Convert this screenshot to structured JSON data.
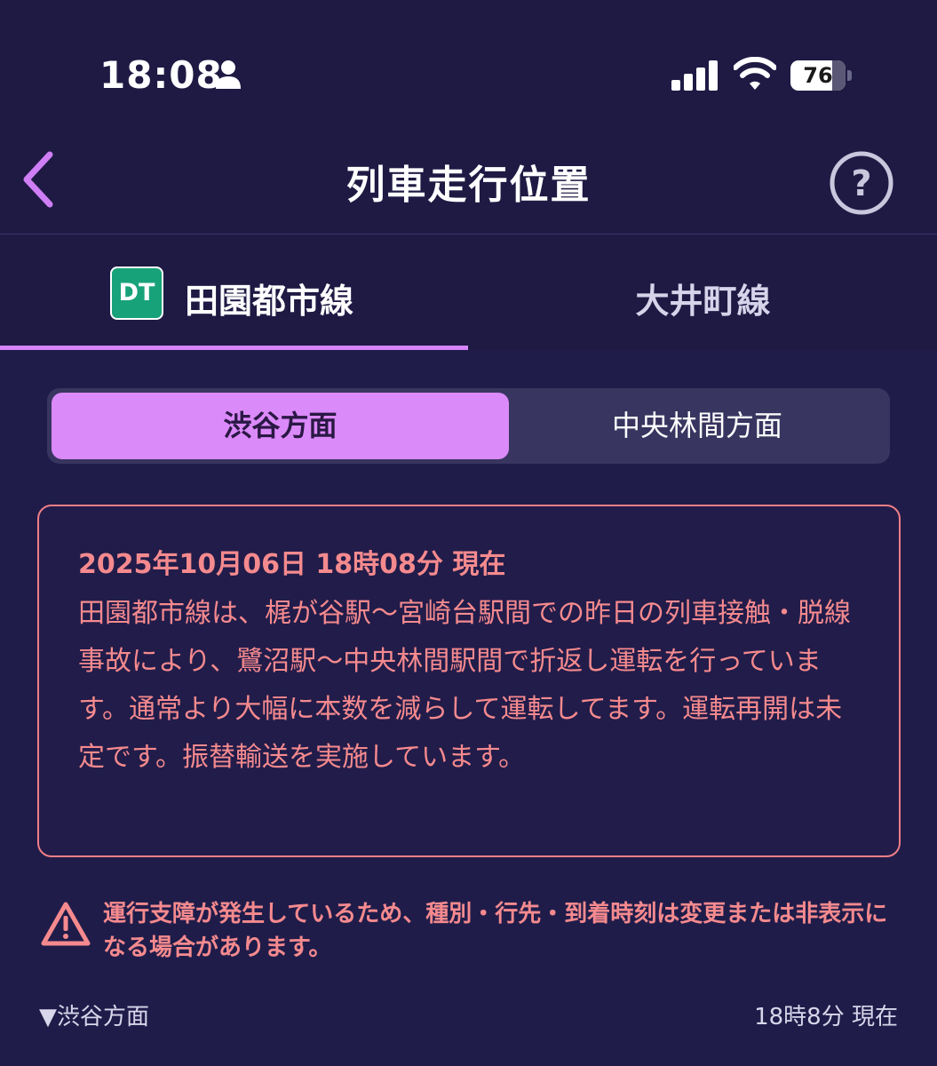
{
  "status_bar": {
    "time": "18:08",
    "battery_level": "76",
    "battery_fraction": 0.76
  },
  "header": {
    "title": "列車走行位置",
    "back_icon": "chevron-left-icon",
    "help_icon": "question-circle-icon"
  },
  "line_tabs": [
    {
      "badge": "DT",
      "label": "田園都市線",
      "selected": true,
      "badge_color": "#18a27a"
    },
    {
      "label": "大井町線",
      "selected": false
    }
  ],
  "direction_tabs": [
    {
      "label": "渋谷方面",
      "selected": true
    },
    {
      "label": "中央林間方面",
      "selected": false
    }
  ],
  "notice": {
    "datetime": "2025年10月06日 18時08分 現在",
    "message": "田園都市線は、梶が谷駅〜宮崎台駅間での昨日の列車接触・脱線事故により、鷺沼駅〜中央林間駅間で折返し運転を行っています。通常より大幅に本数を減らして運転してます。運転再開は未定です。振替輸送を実施しています。"
  },
  "warning": {
    "icon": "warning-triangle-icon",
    "text": "運行支障が発生しているため、種別・行先・到着時刻は変更または非表示になる場合があります。"
  },
  "section": {
    "direction_label": "▼渋谷方面",
    "updated_time": "18時8分 現在"
  },
  "colors": {
    "background": "#201c4a",
    "accent": "#d684f9",
    "alert": "#f58a8e",
    "line_badge": "#18a27a"
  }
}
